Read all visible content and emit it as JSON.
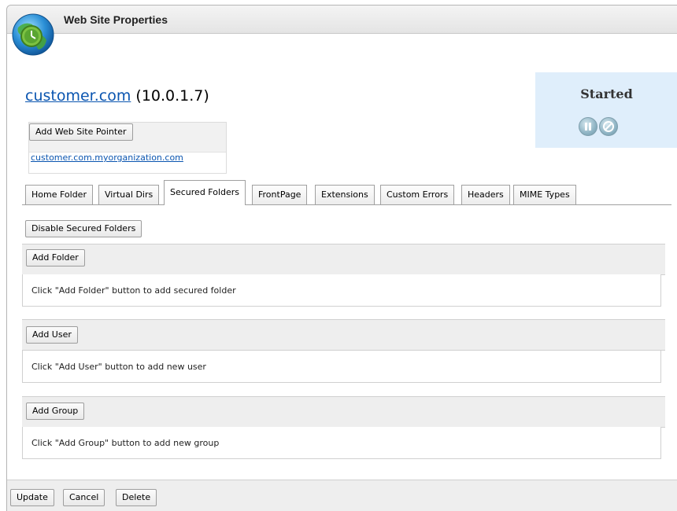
{
  "window": {
    "title": "Web Site Properties",
    "app_icon": "globe-clock-icon"
  },
  "site": {
    "name": "customer.com",
    "ip": "(10.0.1.7)"
  },
  "status": {
    "text": "Started",
    "pause_icon": "pause-icon",
    "stop_icon": "stop-icon"
  },
  "pointer": {
    "add_label": "Add Web Site Pointer",
    "link": "customer.com.myorganization.com"
  },
  "tabs": [
    {
      "label": "Home Folder"
    },
    {
      "label": "Virtual Dirs"
    },
    {
      "label": "Secured Folders"
    },
    {
      "label": "FrontPage"
    },
    {
      "label": "Extensions"
    },
    {
      "label": "Custom Errors"
    },
    {
      "label": "Headers"
    },
    {
      "label": "MIME Types"
    }
  ],
  "active_tab": "Secured Folders",
  "secured": {
    "disable_label": "Disable Secured Folders",
    "folders": {
      "add_label": "Add Folder",
      "empty_msg": "Click \"Add Folder\" button to add secured folder"
    },
    "users": {
      "add_label": "Add User",
      "empty_msg": "Click \"Add User\" button to add new user"
    },
    "groups": {
      "add_label": "Add Group",
      "empty_msg": "Click \"Add Group\" button to add new group"
    }
  },
  "footer": {
    "update_label": "Update",
    "cancel_label": "Cancel",
    "delete_label": "Delete"
  }
}
